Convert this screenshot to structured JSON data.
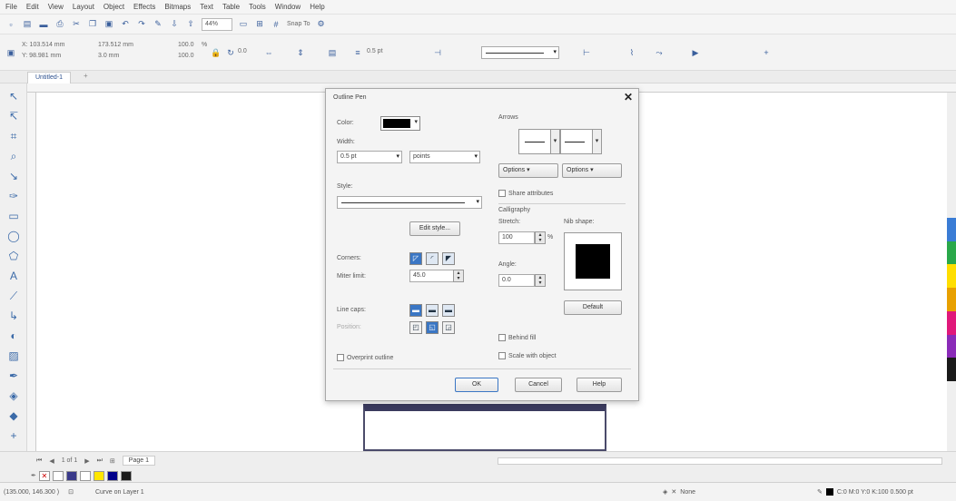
{
  "menubar": [
    "File",
    "Edit",
    "View",
    "Layout",
    "Object",
    "Effects",
    "Bitmaps",
    "Text",
    "Table",
    "Tools",
    "Window",
    "Help"
  ],
  "standard_toolbar": {
    "zoom": "44%",
    "snap_to": "Snap To"
  },
  "property_bar": {
    "x": "X: 103.514 mm",
    "y": "Y: 98.981 mm",
    "width": "173.512 mm",
    "height": "3.0 mm",
    "scale_w": "100.0",
    "scale_h": "100.0",
    "percent": "%",
    "rotation": "0.0",
    "outline_width": "0.5 pt"
  },
  "document_tab": "Untitled-1",
  "outline_pen_dialog": {
    "title": "Outline Pen",
    "color_label": "Color:",
    "color_value": "#000000",
    "width_label": "Width:",
    "width_value": "0.5 pt",
    "width_unit": "points",
    "style_label": "Style:",
    "edit_style_button": "Edit style...",
    "corners_label": "Corners:",
    "miter_limit_label": "Miter limit:",
    "miter_limit_value": "45.0",
    "line_caps_label": "Line caps:",
    "position_label": "Position:",
    "overprint_label": "Overprint outline",
    "arrows_label": "Arrows",
    "options_left": "Options",
    "options_right": "Options",
    "share_attributes": "Share attributes",
    "calligraphy_label": "Calligraphy",
    "stretch_label": "Stretch:",
    "stretch_value": "100",
    "stretch_unit": "%",
    "nib_shape_label": "Nib shape:",
    "angle_label": "Angle:",
    "angle_value": "0.0",
    "default_button": "Default",
    "behind_fill": "Behind fill",
    "scale_with_object": "Scale with object",
    "ok_button": "OK",
    "cancel_button": "Cancel",
    "help_button": "Help"
  },
  "page_nav": {
    "page_count": "1 of 1",
    "page_tab": "Page 1"
  },
  "status_bar": {
    "coords": "(135.000, 146.300 )",
    "layer_text": "Curve on Layer 1",
    "fill_text": "None",
    "outline_text": "C:0 M:0 Y:0 K:100 0.500 pt"
  },
  "palette_colors": [
    "#ffffff",
    "#3a3a8a",
    "#ffffff",
    "#ffe600",
    "#00008b",
    "#1a1a1a"
  ],
  "side_colorbar": [
    "#3a7cd5",
    "#2aa84a",
    "#ffde00",
    "#e8a000",
    "#e0187a",
    "#8a2bb8",
    "#1a1a1a"
  ]
}
